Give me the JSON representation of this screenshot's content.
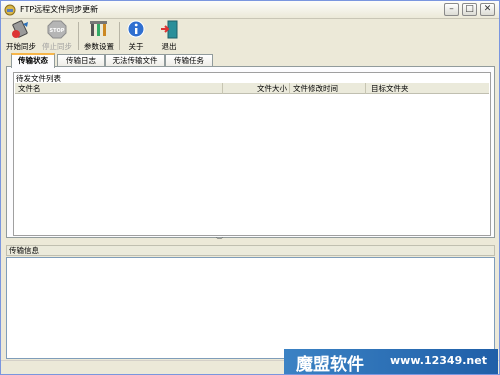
{
  "window": {
    "title": "FTP远程文件同步更新",
    "min_glyph": "–",
    "max_glyph": "□",
    "close_glyph": "✕"
  },
  "toolbar": {
    "start_sync": "开始同步",
    "stop_sync": "停止同步",
    "settings": "参数设置",
    "about": "关于",
    "exit": "退出"
  },
  "tabs": [
    "传输状态",
    "传输日志",
    "无法传输文件",
    "传输任务"
  ],
  "pending": {
    "group_title": "待发文件列表",
    "columns": [
      "文件名",
      "文件大小",
      "文件修改时间",
      "目标文件夹"
    ]
  },
  "transfer_info": {
    "header": "传输信息"
  },
  "watermark": {
    "brand": "魔盟软件",
    "url": "www.12349.net"
  },
  "colors": {
    "window_bg": "#ece9d8",
    "active_tab_accent": "#f7b64a",
    "watermark_bg": "#2b6fb8"
  }
}
